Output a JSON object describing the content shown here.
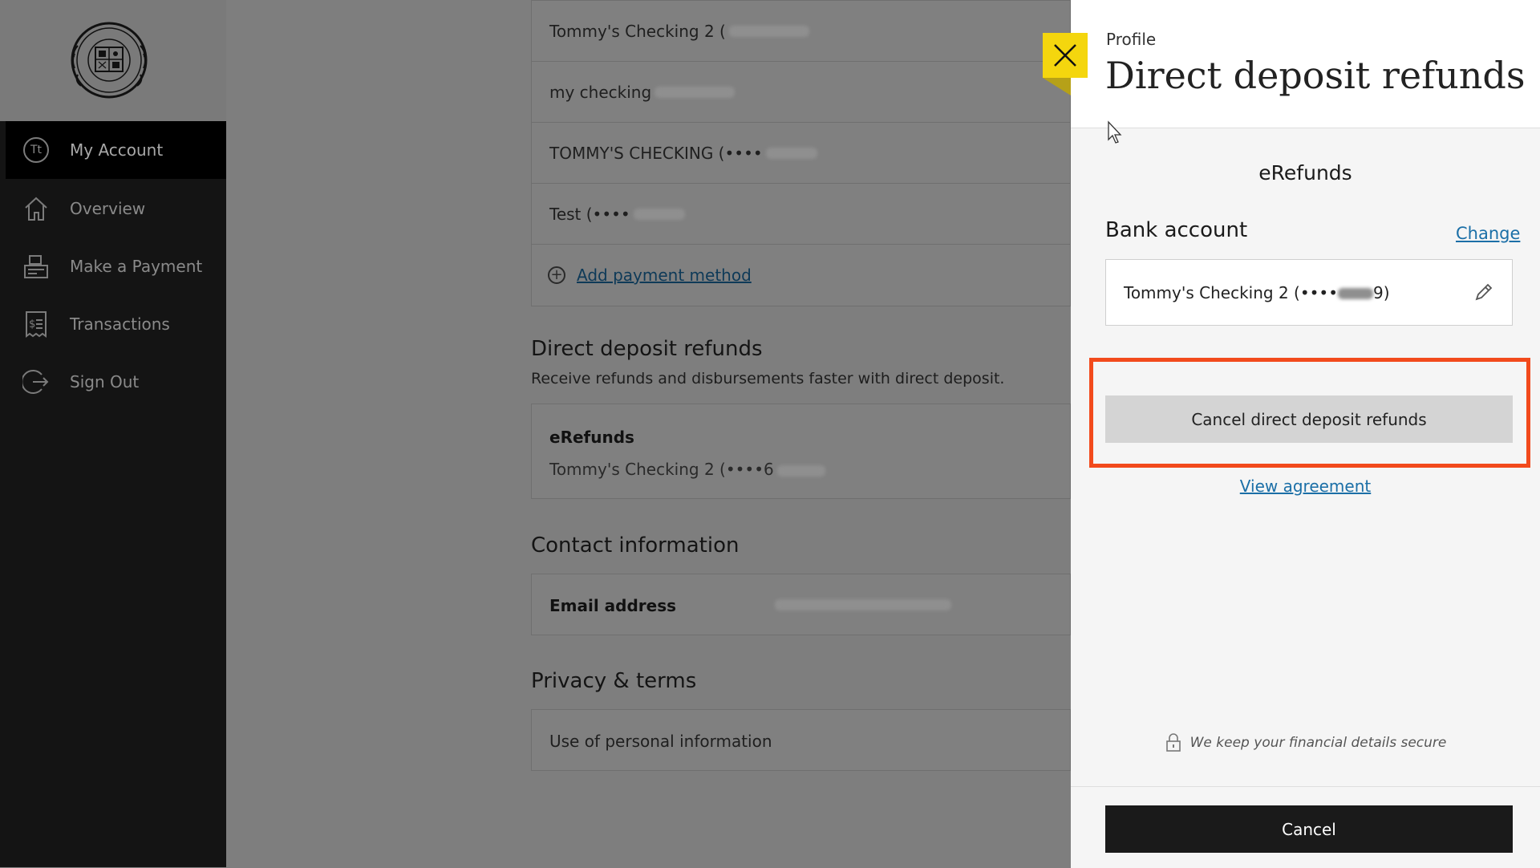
{
  "sidebar": {
    "items": [
      {
        "label": "My Account",
        "icon": "avatar-icon",
        "avatar_text": "Tt"
      },
      {
        "label": "Overview",
        "icon": "home-icon"
      },
      {
        "label": "Make a Payment",
        "icon": "register-icon"
      },
      {
        "label": "Transactions",
        "icon": "receipt-icon"
      },
      {
        "label": "Sign Out",
        "icon": "sign-out-icon"
      }
    ]
  },
  "main": {
    "payment_methods": [
      {
        "name": "Tommy's Checking 2 ("
      },
      {
        "name": "my checking"
      },
      {
        "name": "TOMMY'S CHECKING (••••"
      },
      {
        "name": "Test (••••"
      }
    ],
    "add_payment_label": "Add payment method",
    "direct_deposit": {
      "heading": "Direct deposit refunds",
      "description": "Receive refunds and disbursements faster with direct deposit.",
      "card_title": "eRefunds",
      "card_account": "Tommy's Checking 2 (••••6"
    },
    "contact": {
      "heading": "Contact information",
      "email_label": "Email address"
    },
    "privacy": {
      "heading": "Privacy & terms",
      "item": "Use of personal information"
    }
  },
  "drawer": {
    "breadcrumb": "Profile",
    "title": "Direct deposit refunds",
    "section_title": "eRefunds",
    "bank_heading": "Bank account",
    "change_label": "Change",
    "account_value_prefix": "Tommy's Checking 2 (••••",
    "account_value_suffix": "9)",
    "cancel_dd_label": "Cancel direct deposit refunds",
    "view_agreement_label": "View agreement",
    "secure_note": "We keep your financial details secure",
    "cancel_label": "Cancel"
  },
  "colors": {
    "highlight": "#f24a1c",
    "close_button": "#f4d60e",
    "link": "#1b6fa7"
  }
}
